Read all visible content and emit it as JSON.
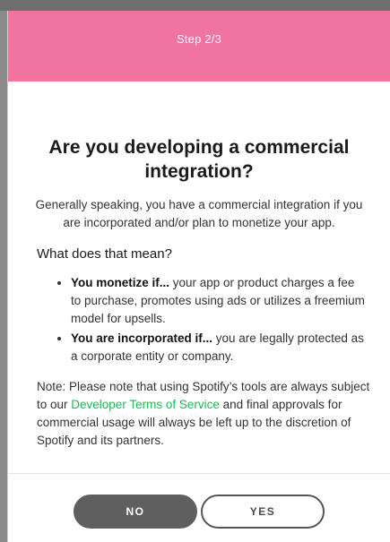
{
  "header": {
    "step": "Step 2/3"
  },
  "content": {
    "title": "Are you developing a commercial integration?",
    "subtitle": "Generally speaking, you have a commercial integration if you are incorporated and/or plan to monetize your app.",
    "section_heading": "What does that mean?",
    "bullets": [
      {
        "bold": "You monetize if...",
        "text": " your app or product charges a fee to purchase, promotes using ads or utilizes a freemium model for upsells."
      },
      {
        "bold": "You are incorporated if...",
        "text": " you are legally protected as a corporate entity or company."
      }
    ],
    "note": {
      "before": "Note: Please note that using Spotify’s tools are always subject to our ",
      "link": "Developer Terms of Service",
      "after": " and final approvals for commercial usage will always be left up to the discretion of Spotify and its partners."
    }
  },
  "footer": {
    "no_label": "NO",
    "yes_label": "YES"
  },
  "colors": {
    "header": "#f173a0",
    "link": "#1db954",
    "no_button": "#5f5f5f"
  }
}
